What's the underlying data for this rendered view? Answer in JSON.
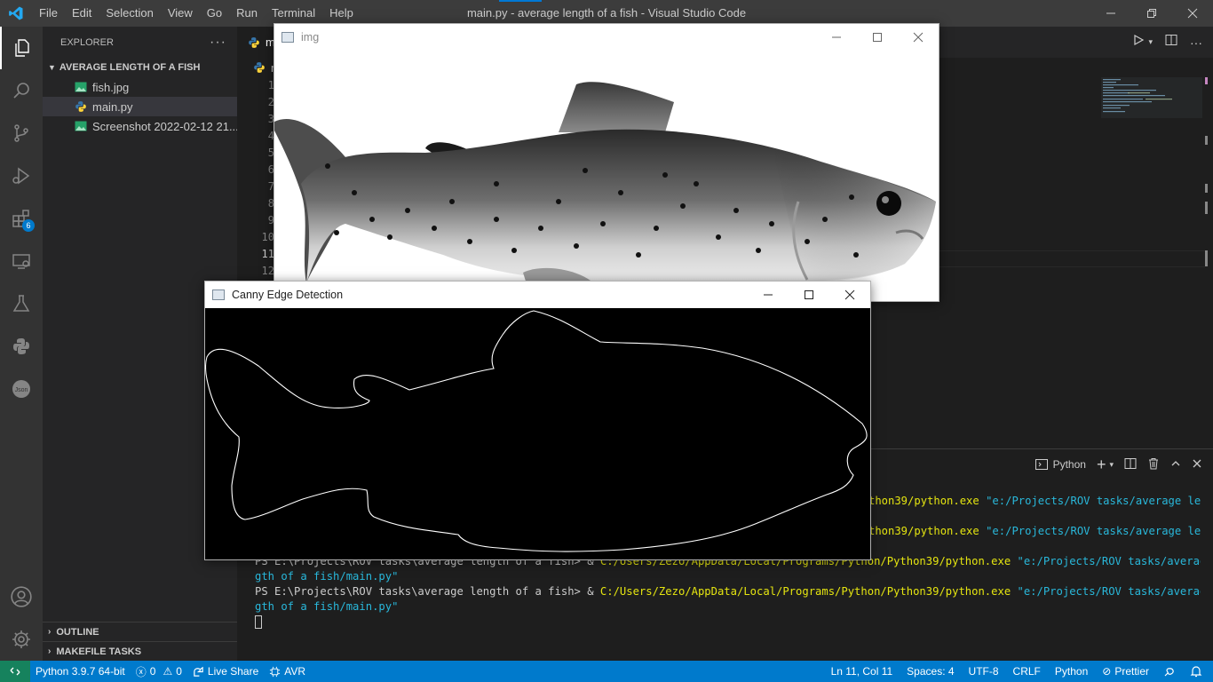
{
  "window": {
    "title": "main.py - average length of a fish - Visual Studio Code",
    "menu": [
      "File",
      "Edit",
      "Selection",
      "View",
      "Go",
      "Run",
      "Terminal",
      "Help"
    ]
  },
  "activity": {
    "extensions_badge": "6",
    "items": [
      "explorer-icon",
      "search-icon",
      "source-control-icon",
      "run-debug-icon",
      "extensions-icon",
      "remote-explorer-icon",
      "testing-icon",
      "python-icon",
      "json-icon",
      "account-icon",
      "settings-gear-icon"
    ]
  },
  "sidebar": {
    "header": "EXPLORER",
    "folder": "AVERAGE LENGTH OF A FISH",
    "files": [
      {
        "name": "fish.jpg",
        "type": "image"
      },
      {
        "name": "main.py",
        "type": "python",
        "selected": true
      },
      {
        "name": "Screenshot 2022-02-12 21...",
        "type": "image"
      }
    ],
    "outline": "OUTLINE",
    "makefile": "MAKEFILE TASKS"
  },
  "editor": {
    "tab_label": "m",
    "breadcrumb": "m",
    "line_numbers": [
      "1",
      "2",
      "3",
      "4",
      "5",
      "6",
      "7",
      "8",
      "9",
      "10",
      "11",
      "12"
    ],
    "current_line": "11"
  },
  "panel": {
    "shell_label": "Python",
    "lines": [
      {
        "prompt": "",
        "exe": "thon39/python.exe",
        "arg": "\"e:/Projects/ROV tasks/average len"
      },
      {
        "prompt": "",
        "exe": "thon39/python.exe",
        "arg": "\"e:/Projects/ROV tasks/average len"
      },
      {
        "prompt": "PS E:\\Projects\\ROV tasks\\average length of a fish> & ",
        "exe": "C:/Users/Zezo/AppData/Local/Programs/Python/Python39/python.exe",
        "arg": "\"e:/Projects/ROV tasks/average len"
      },
      {
        "cont": "gth of a fish/main.py\""
      },
      {
        "prompt": "PS E:\\Projects\\ROV tasks\\average length of a fish> & ",
        "exe": "C:/Users/Zezo/AppData/Local/Programs/Python/Python39/python.exe",
        "arg": "\"e:/Projects/ROV tasks/average len"
      },
      {
        "cont": "gth of a fish/main.py\""
      }
    ]
  },
  "statusbar": {
    "python": "Python 3.9.7 64-bit",
    "errors": "0",
    "warnings": "0",
    "live_share": "Live Share",
    "avr": "AVR",
    "position": "Ln 11, Col 11",
    "spaces": "Spaces: 4",
    "encoding": "UTF-8",
    "eol": "CRLF",
    "language": "Python",
    "prettier": "Prettier"
  },
  "img_window": {
    "title": "img"
  },
  "canny_window": {
    "title": "Canny Edge Detection"
  },
  "colors": {
    "accent": "#007acc",
    "terminal_yellow": "#e5e510",
    "terminal_cyan": "#29b8db",
    "remote_green": "#16825d"
  }
}
